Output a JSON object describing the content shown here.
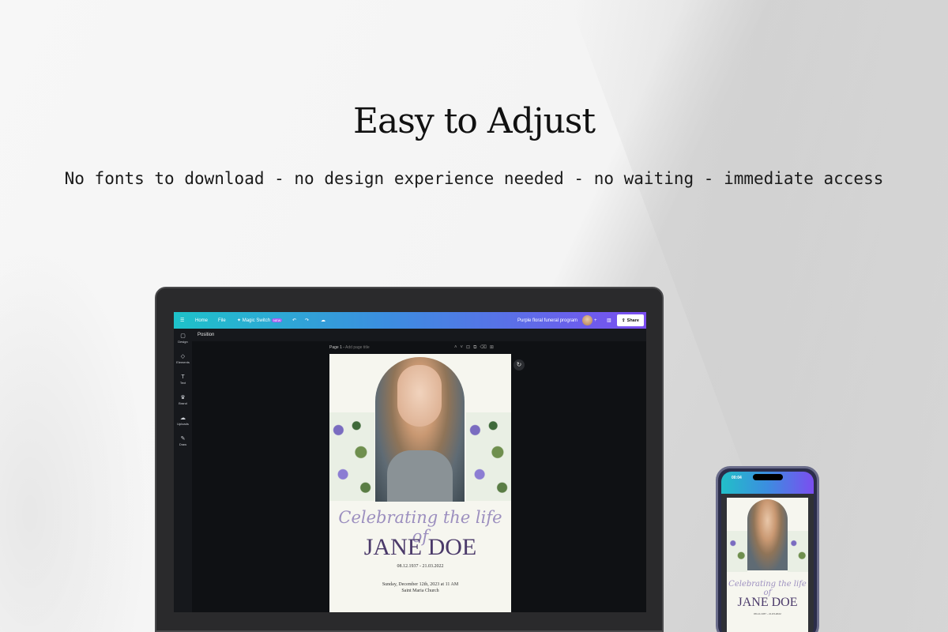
{
  "headline": "Easy to Adjust",
  "subline": "No fonts to download - no design experience needed - no waiting - immediate access",
  "editor": {
    "topbar": {
      "menu_icon": "menu-icon",
      "home": "Home",
      "file": "File",
      "magic_switch": "Magic Switch",
      "new_badge": "NEW",
      "doc_title": "Purple floral funeral program",
      "share": "Share"
    },
    "sidebar": [
      {
        "label": "Design",
        "icon": "▢"
      },
      {
        "label": "Elements",
        "icon": "◇"
      },
      {
        "label": "Text",
        "icon": "T"
      },
      {
        "label": "Brand",
        "icon": "♛"
      },
      {
        "label": "Uploads",
        "icon": "☁"
      },
      {
        "label": "Draw",
        "icon": "✎"
      }
    ],
    "panel_title": "Position",
    "page_label": "Page 1 -",
    "page_title_placeholder": "Add page title"
  },
  "document": {
    "celebrating": "Celebrating the life of",
    "name": "JANE DOE",
    "dates": "08.12.1937 - 21.03.2022",
    "service_line1": "Sunday, December 12th, 2023 at 11 AM",
    "service_line2": "Saint Maria Church"
  },
  "phone": {
    "time": "00:04",
    "celebrating": "Celebrating the life of",
    "name": "JANE DOE",
    "dates": "08.12.1937 - 21.03.2022"
  }
}
